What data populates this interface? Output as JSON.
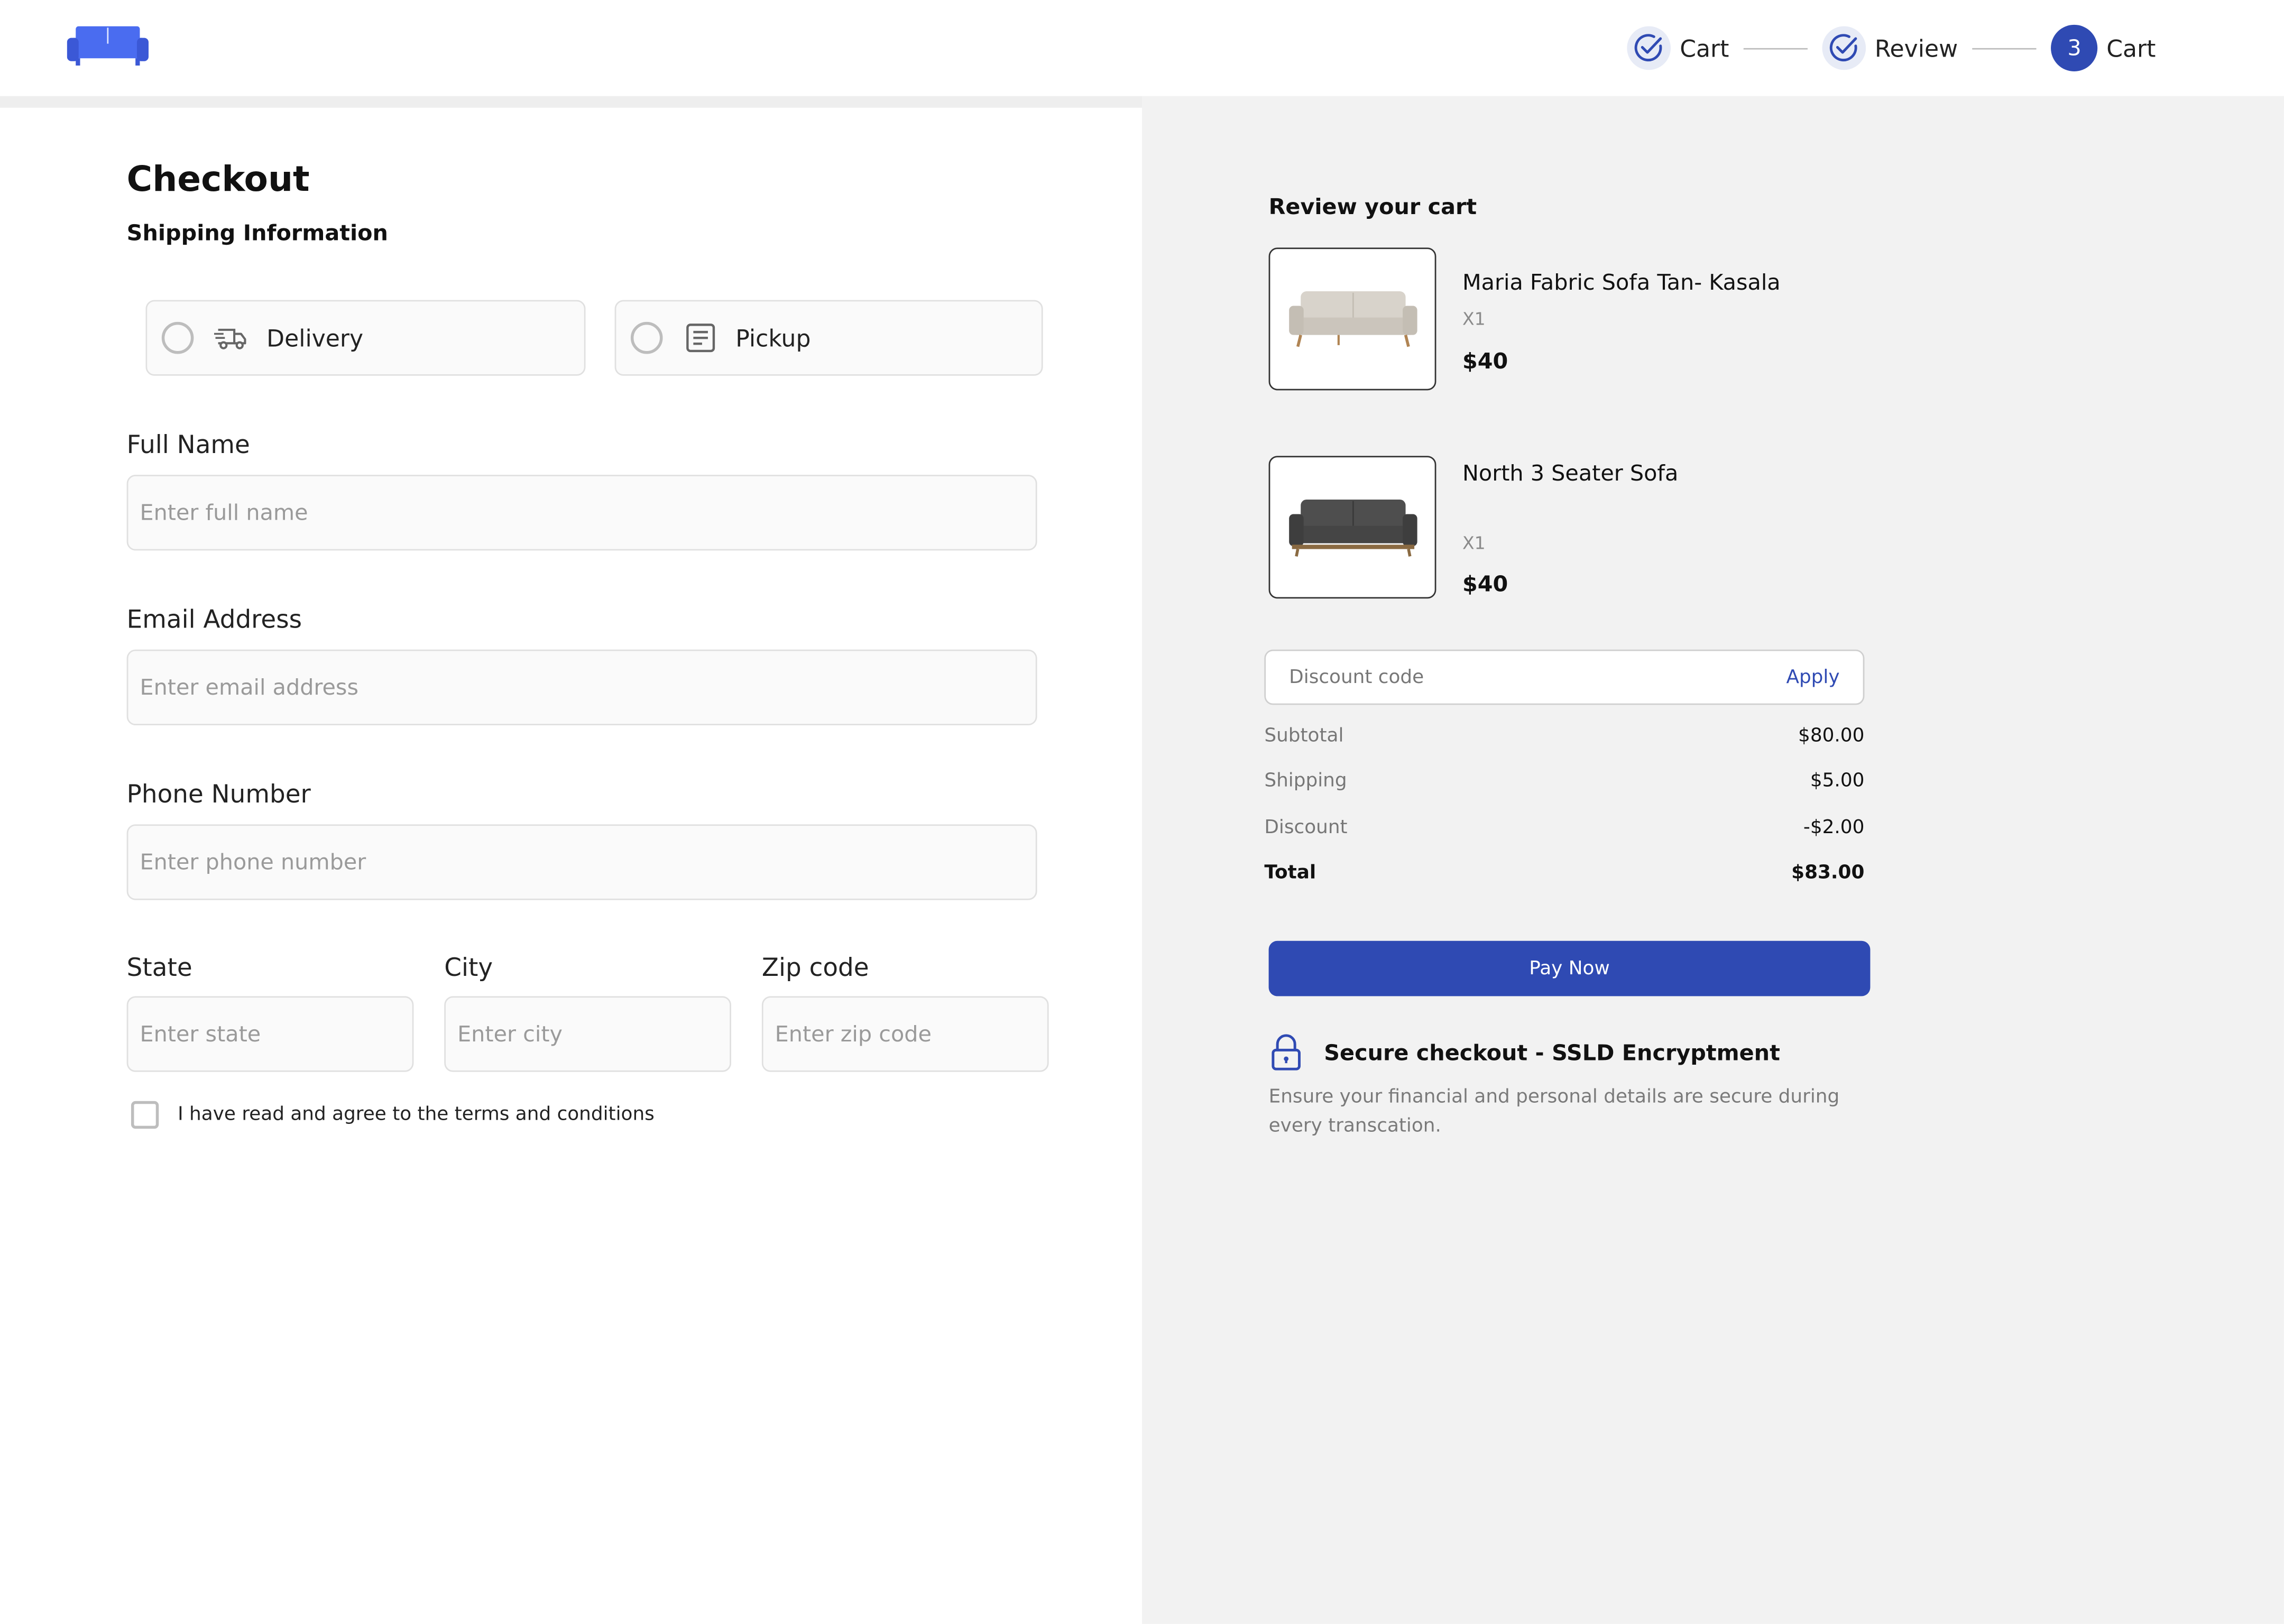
{
  "header": {
    "steps": [
      {
        "label": "Cart",
        "state": "done"
      },
      {
        "label": "Review",
        "state": "done"
      },
      {
        "label": "Cart",
        "state": "current",
        "number": "3"
      }
    ]
  },
  "checkout": {
    "title": "Checkout",
    "subtitle": "Shipping Information",
    "methods": [
      {
        "label": "Delivery",
        "icon": "delivery-truck-icon"
      },
      {
        "label": "Pickup",
        "icon": "pickup-receipt-icon"
      }
    ],
    "fields": {
      "full_name": {
        "label": "Full Name",
        "placeholder": "Enter full name",
        "value": ""
      },
      "email": {
        "label": "Email Address",
        "placeholder": "Enter email address",
        "value": ""
      },
      "phone": {
        "label": "Phone Number",
        "placeholder": "Enter phone number",
        "value": ""
      },
      "state": {
        "label": "State",
        "placeholder": "Enter state",
        "value": ""
      },
      "city": {
        "label": "City",
        "placeholder": "Enter city",
        "value": ""
      },
      "zip": {
        "label": "Zip code",
        "placeholder": "Enter zip code",
        "value": ""
      }
    },
    "terms": "I have read and agree to the terms and conditions"
  },
  "cart": {
    "title": "Review your cart",
    "items": [
      {
        "name": "Maria Fabric Sofa Tan- Kasala",
        "qty": "X1",
        "price": "$40"
      },
      {
        "name": "North 3 Seater Sofa",
        "qty": "X1",
        "price": "$40"
      }
    ],
    "discount": {
      "placeholder": "Discount code",
      "apply": "Apply"
    },
    "summary": {
      "subtotal": {
        "label": "Subtotal",
        "value": "$80.00"
      },
      "shipping": {
        "label": "Shipping",
        "value": "$5.00"
      },
      "discount": {
        "label": "Discount",
        "value": "-$2.00"
      },
      "total": {
        "label": "Total",
        "value": "$83.00"
      }
    },
    "pay": "Pay Now",
    "secure": {
      "title": "Secure checkout - SSLD Encryptment",
      "desc": "Ensure your financial and personal details are secure during every transcation."
    }
  },
  "colors": {
    "accent": "#2f4ab3",
    "panel": "#f2f2f2",
    "border": "#e0e0e0"
  }
}
